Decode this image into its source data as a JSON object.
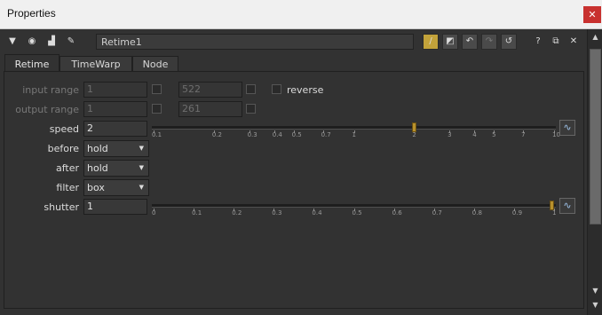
{
  "window": {
    "title": "Properties",
    "close_icon": "close-icon"
  },
  "toolbar": {
    "node_name": "Retime1",
    "icons": [
      "collapse-triangle-icon",
      "viewer-icon",
      "node-graph-icon",
      "settings-wrench-icon",
      "color-swatch-icon",
      "color-picker-icon",
      "undo-icon",
      "redo-icon",
      "revert-icon",
      "help-icon",
      "float-window-icon",
      "close-panel-icon"
    ]
  },
  "tabs": [
    {
      "label": "Retime",
      "active": true
    },
    {
      "label": "TimeWarp",
      "active": false
    },
    {
      "label": "Node",
      "active": false
    }
  ],
  "params": {
    "input_range": {
      "label": "input range",
      "from": "1",
      "to": "522",
      "reverse_label": "reverse"
    },
    "output_range": {
      "label": "output range",
      "from": "1",
      "to": "261"
    },
    "speed": {
      "label": "speed",
      "value": "2",
      "ticks": [
        "0.1",
        "0.2",
        "0.3",
        "0.4",
        "0.5",
        "0.7",
        "1",
        "2",
        "3",
        "4",
        "5",
        "7",
        "10"
      ],
      "position": 0.65
    },
    "before": {
      "label": "before",
      "value": "hold"
    },
    "after": {
      "label": "after",
      "value": "hold"
    },
    "filter": {
      "label": "filter",
      "value": "box"
    },
    "shutter": {
      "label": "shutter",
      "value": "1",
      "ticks": [
        "0",
        "0.1",
        "0.2",
        "0.3",
        "0.4",
        "0.5",
        "0.6",
        "0.7",
        "0.8",
        "0.9",
        "1"
      ],
      "position": 1.0
    }
  },
  "colors": {
    "background": "#323232",
    "titlebar": "#f0f0f0",
    "close": "#c8312f",
    "slider_handle": "#b8912c",
    "curve_icon": "#9ec3ea"
  }
}
